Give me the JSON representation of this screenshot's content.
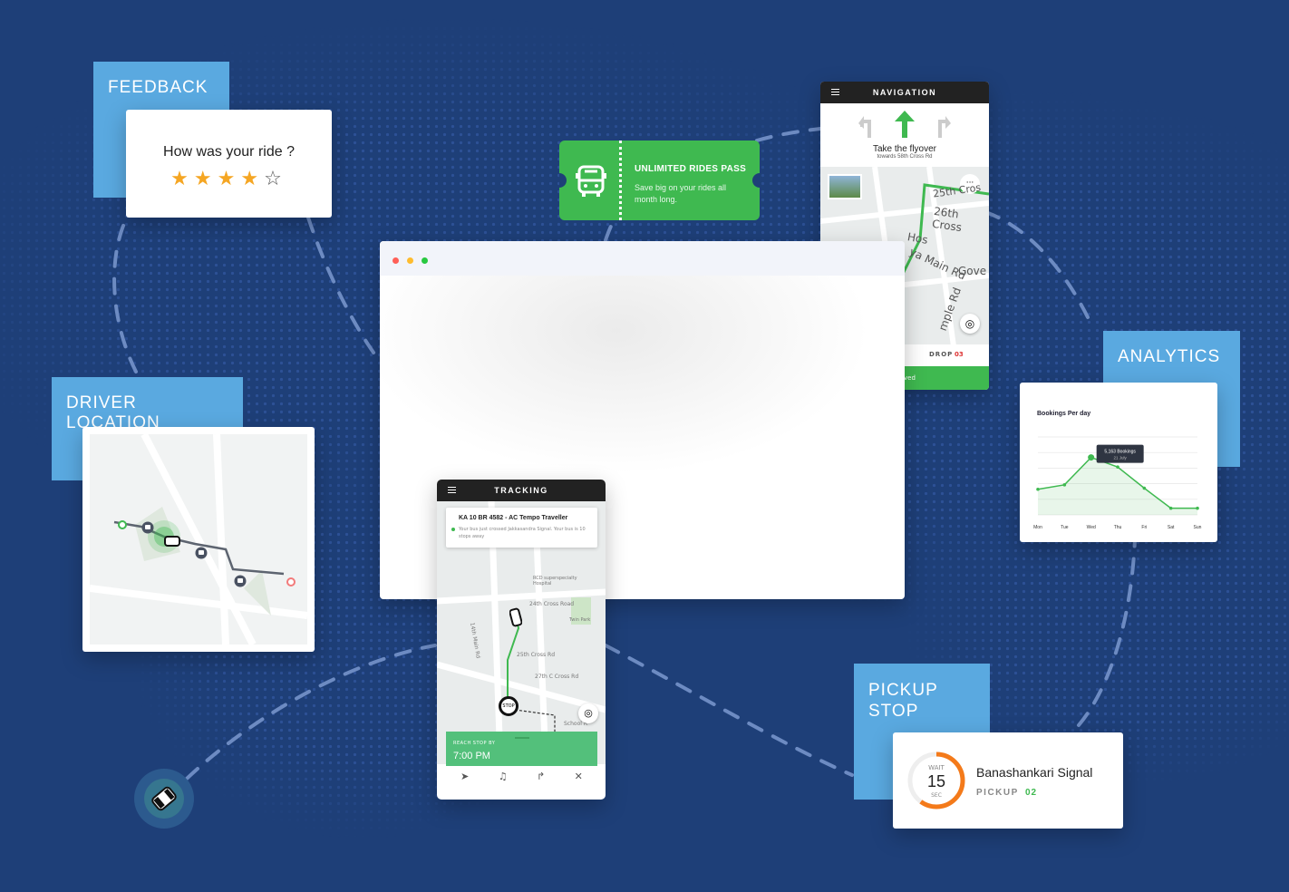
{
  "feedback": {
    "tag": "FEEDBACK",
    "question": "How was your ride ?",
    "rating": 4,
    "max_rating": 5
  },
  "pass": {
    "title": "UNLIMITED RIDES PASS",
    "subtitle": "Save big on your rides all month long.",
    "color": "#3fb950"
  },
  "navigation": {
    "title": "NAVIGATION",
    "instruction": "Take the flyover",
    "subinstruction": "towards 58th Cross Rd",
    "streets": [
      "25th Cros",
      "26th Cross",
      "ya Main Rd",
      "Gove",
      "Hos",
      "mple Rd"
    ],
    "drop_label": "DROP",
    "drop_value": "03",
    "footer_text": "ved"
  },
  "driver_location": {
    "tag": "DRIVER LOCATION"
  },
  "tracking": {
    "title": "TRACKING",
    "vehicle": "KA 10 BR 4582 - AC Tempo Traveller",
    "status": "Your bus just crossed Jakkasandra Signal. Your bus is 10 stops away",
    "reach_label": "REACH STOP BY",
    "reach_time": "7:00 PM",
    "streets": [
      "14th Main Rd",
      "24th Cross Road",
      "25th Cross Rd",
      "27th C Cross Rd",
      "RCD superspecialty Hospital",
      "Twin Park",
      "School R"
    ]
  },
  "analytics": {
    "tag": "ANALYTICS",
    "chart_title": "Bookings Per day",
    "tooltip_value": "5,163 Bookings",
    "tooltip_date": "21 July"
  },
  "chart_data": {
    "type": "area",
    "title": "Bookings Per day",
    "categories": [
      "Mon",
      "Tue",
      "Wed",
      "Thu",
      "Fri",
      "Sat",
      "Sun"
    ],
    "values": [
      2300,
      2700,
      5163,
      4300,
      2400,
      600,
      600
    ],
    "highlight_index": 2,
    "ylim": [
      0,
      7000
    ],
    "grid": true,
    "color": "#3fb950"
  },
  "pickup": {
    "tag_line1": "PICKUP",
    "tag_line2": "STOP",
    "wait_label": "WAIT",
    "wait_value": "15",
    "wait_unit": "SEC",
    "wait_fraction": 0.6,
    "stop_name": "Banashankari Signal",
    "pickup_label": "PICKUP",
    "pickup_value": "02"
  },
  "browser": {
    "dots": [
      "#ff5f57",
      "#febc2e",
      "#28c840"
    ]
  }
}
